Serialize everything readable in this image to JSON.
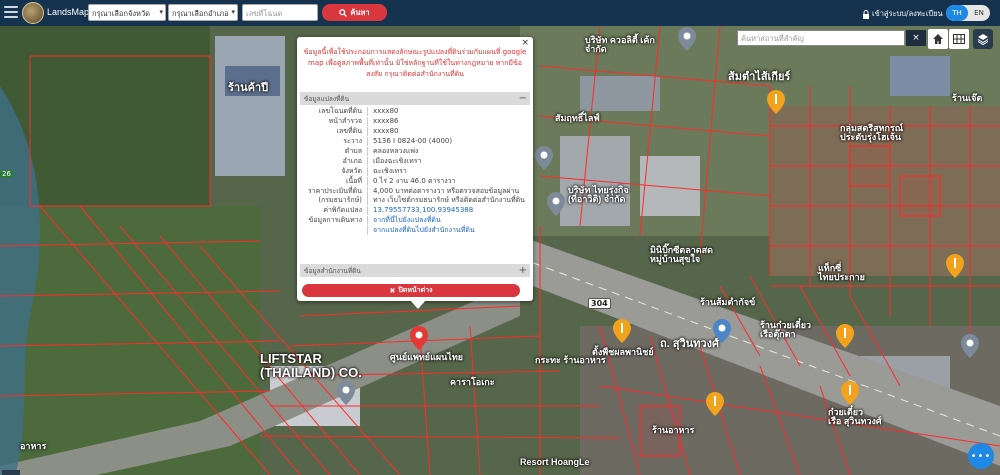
{
  "header": {
    "brand": "LandsMaps",
    "province_select": "กรุณาเลือกจังหวัด",
    "district_select": "กรุณาเลือกอำเภอ",
    "parcel_placeholder": "เลขที่โฉนด",
    "search_label": "ค้นหา",
    "login_label": "เข้าสู่ระบบ/ลงทะเบียน",
    "lang_th": "TH",
    "lang_en": "EN"
  },
  "map": {
    "search_placeholder": "ค้นหาสถานที่สำคัญ",
    "clear_label": "×",
    "route_tag": "26",
    "road_shield": "304",
    "labels": [
      "ร้านค้าปี",
      "บริษัท ควอลิตี้ เค้ก\nจำกัด",
      "สัมฤทธิ์ไลฟ์",
      "ส้มตำไส้เกียร์",
      "ร้านเจ๊ต",
      "กลุ่มสตรีสหกรณ์\nประตับรุ่งโฮเจ้น",
      "บริษัท ไทยรุ่งกิจ\n(ที่อาวิติ) จำกัด",
      "มินิบิ๊กซีตลาดสด\nหมู่บ้านสุขใจ",
      "แท็กซี่\nไทยประกาย",
      "ร้านส้มตำกัจข์",
      "ร้านก๋วยเตี๋ยว\nเรือตุ๊กตา",
      "LIFTSTAR\n(THAILAND) CO.",
      "ศูนย์แพทย์แผนไทย",
      "กระทะ ร้านอาหาร",
      "ตั้งพืชผลพานิชย์",
      "ถ. สุวินทวงศ์",
      "ก๋วยเตี๋ยว\nเรือ สุวินทวงศ์",
      "Resort HoangLe",
      "อาหาร",
      "คาราโอเกะ",
      "ร้านอาหาร"
    ]
  },
  "popup": {
    "close": "×",
    "notice": "ข้อมูลนี้เพื่อใช้ประกอบการแสดงลักษณะรูปแปลงที่ดินร่วมกับแผนที่ google map เพื่อดูสภาพพื้นที่เท่านั้น มิใช่หลักฐานที่ใช้ในทางกฎหมาย หากมีข้อสงสัย กรุณาติดต่อสำนักงานที่ดิน",
    "section1": "ข้อมูลแปลงที่ดิน",
    "section2": "ข้อมูลสำนักงานที่ดิน",
    "rows": [
      {
        "k": "เลขโฉนดที่ดิน",
        "v": "xxxx80"
      },
      {
        "k": "หน้าสำรวจ",
        "v": "xxxx86"
      },
      {
        "k": "เลขที่ดิน",
        "v": "xxxx80"
      },
      {
        "k": "ระวาง",
        "v": "5136 I 0824-00 (4000)"
      },
      {
        "k": "ตำบล",
        "v": "คลองหลวงแพ่ง"
      },
      {
        "k": "อำเภอ",
        "v": "เมืองฉะเชิงเทรา"
      },
      {
        "k": "จังหวัด",
        "v": "ฉะเชิงเทรา"
      },
      {
        "k": "เนื้อที่",
        "v": "0 ไร่ 2 งาน 46.0 ตารางวา"
      },
      {
        "k": "ราคาประเมินที่ดิน\n(กรมธนารักษ์)",
        "v": "4,000 บาทต่อตารางวา หรือตรวจสอบข้อมูลผ่านทาง เว็บไซต์กรมธนารักษ์ หรือติดต่อสำนักงานที่ดิน"
      },
      {
        "k": "ค่าพิกัดแปลง",
        "v": "13.79557733,100.93945388"
      },
      {
        "k": "ข้อมูลการเดินทาง",
        "v": "จากที่นี่ไปยังแปลงที่ดิน"
      },
      {
        "k": "",
        "v": "จากแปลงที่ดินไปยังสำนักงานที่ดิน"
      }
    ],
    "close_button": "ปิดหน้าต่าง"
  },
  "colors": {
    "topbar": "#15324f",
    "accent_red": "#d9363e",
    "accent_blue": "#1e88e5",
    "parcel_line": "#ff2a2a"
  },
  "icons": [
    "hamburger-icon",
    "search-icon",
    "lock-icon",
    "home-icon",
    "grid-icon",
    "layers-icon",
    "map-pin-icon",
    "compass-icon",
    "chat-icon"
  ]
}
